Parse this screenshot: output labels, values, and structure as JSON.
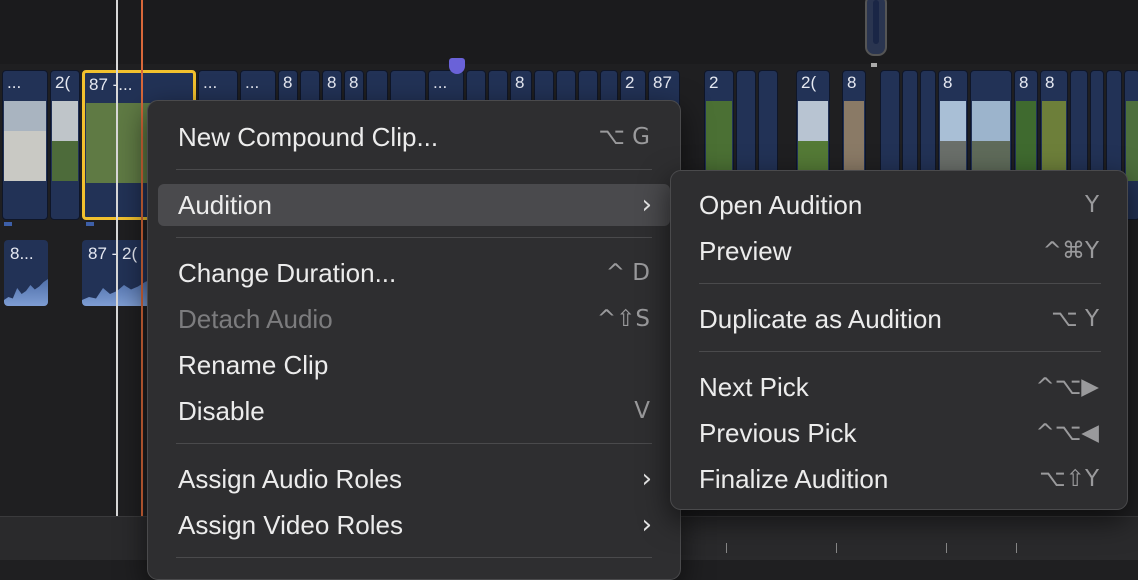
{
  "timeline": {
    "clip_labels": [
      "...",
      "2(",
      "87 -...",
      "...",
      "...",
      "8",
      "8",
      "8",
      "...",
      "8",
      "2",
      "87",
      "2",
      "2(",
      "8",
      "8",
      "8",
      "8"
    ],
    "audio_labels": [
      "8...",
      "87 - 2("
    ]
  },
  "context_menu": {
    "new_compound": {
      "label": "New Compound Clip...",
      "shortcut": "⌥ G"
    },
    "audition": {
      "label": "Audition",
      "chevron": "›"
    },
    "change_duration": {
      "label": "Change Duration...",
      "shortcut": "^ D"
    },
    "detach_audio": {
      "label": "Detach Audio",
      "shortcut": "^⇧S"
    },
    "rename_clip": {
      "label": "Rename Clip"
    },
    "disable": {
      "label": "Disable",
      "shortcut": "V"
    },
    "assign_audio_roles": {
      "label": "Assign Audio Roles",
      "chevron": "›"
    },
    "assign_video_roles": {
      "label": "Assign Video Roles",
      "chevron": "›"
    }
  },
  "audition_submenu": {
    "open_audition": {
      "label": "Open Audition",
      "shortcut": "Y"
    },
    "preview": {
      "label": "Preview",
      "shortcut": "^⌘Y"
    },
    "duplicate": {
      "label": "Duplicate as Audition",
      "shortcut": "⌥ Y"
    },
    "next_pick": {
      "label": "Next Pick",
      "shortcut": "^⌥▶"
    },
    "previous_pick": {
      "label": "Previous Pick",
      "shortcut": "^⌥◀"
    },
    "finalize": {
      "label": "Finalize Audition",
      "shortcut": "⌥⇧Y"
    }
  },
  "colors": {
    "accent_selection": "#f2c12e",
    "playhead": "#d9683a",
    "marker": "#6a62d8",
    "clip": "#223256"
  }
}
